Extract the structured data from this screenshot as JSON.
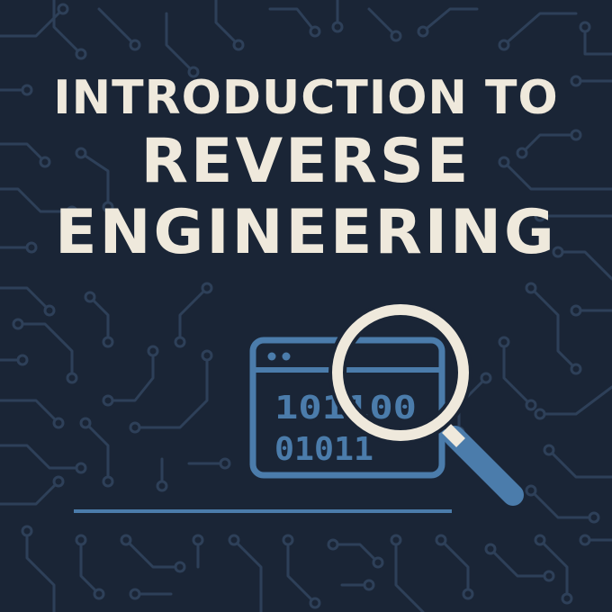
{
  "title": {
    "line1": "INTRODUCTION TO",
    "line2": "REVERSE",
    "line3": "ENGINEERING"
  },
  "illustration": {
    "binary_line1": "101100",
    "binary_line2": "01011",
    "icons": [
      "browser-window-icon",
      "magnifying-glass-icon",
      "circuit-trace-pattern"
    ]
  },
  "colors": {
    "background": "#1a2536",
    "title_text": "#efe9dc",
    "accent_blue": "#4b7cab",
    "circuit_lines": "#2c3d55",
    "lens_ring": "#efe9dc"
  }
}
